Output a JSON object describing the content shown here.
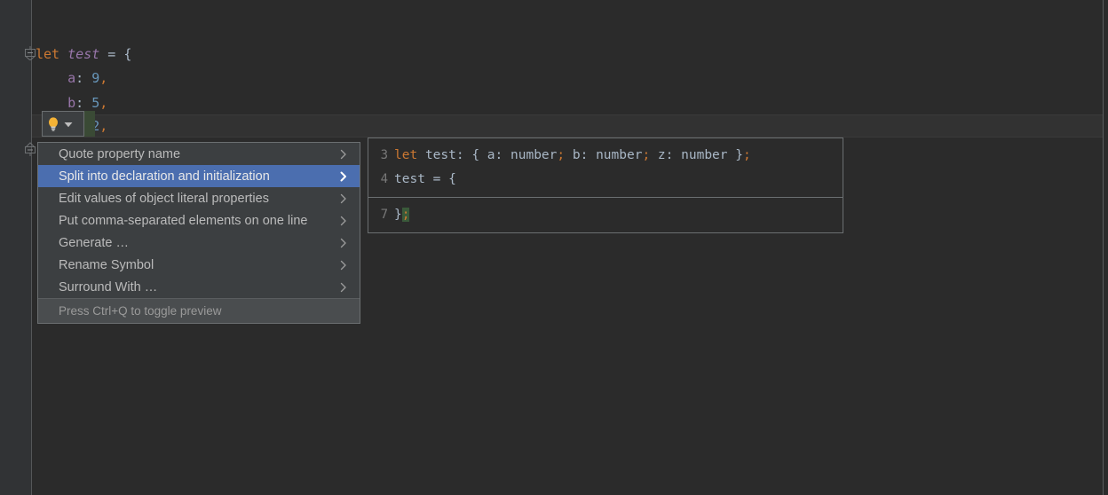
{
  "editor": {
    "background_color": "#2b2b2b",
    "gutter_color": "#313335",
    "current_line_color": "#323232",
    "lines": [
      {
        "indent": 0,
        "tokens": [
          {
            "text": "let",
            "cls": "kw"
          },
          {
            "text": " ",
            "cls": "op"
          },
          {
            "text": "test",
            "cls": "ident"
          },
          {
            "text": " ",
            "cls": "op"
          },
          {
            "text": "=",
            "cls": "op"
          },
          {
            "text": " ",
            "cls": "op"
          },
          {
            "text": "{",
            "cls": "brace"
          }
        ]
      },
      {
        "indent": 1,
        "tokens": [
          {
            "text": "a",
            "cls": "prop"
          },
          {
            "text": ":",
            "cls": "punc"
          },
          {
            "text": " ",
            "cls": "op"
          },
          {
            "text": "9",
            "cls": "num"
          },
          {
            "text": ",",
            "cls": "comma"
          }
        ]
      },
      {
        "indent": 1,
        "tokens": [
          {
            "text": "b",
            "cls": "prop"
          },
          {
            "text": ":",
            "cls": "punc"
          },
          {
            "text": " ",
            "cls": "op"
          },
          {
            "text": "5",
            "cls": "num"
          },
          {
            "text": ",",
            "cls": "comma"
          }
        ]
      },
      {
        "indent": 1,
        "tokens": [
          {
            "text": "z",
            "cls": "prop"
          },
          {
            "text": ":",
            "cls": "punc"
          },
          {
            "text": " ",
            "cls": "op"
          },
          {
            "text": "2",
            "cls": "num"
          },
          {
            "text": ",",
            "cls": "comma"
          }
        ]
      }
    ],
    "line_texts": [
      "let test = {",
      "    a: 9,",
      "    b: 5,",
      "    z: 2,"
    ]
  },
  "bulb_widget": {
    "icon": "lightbulb-icon",
    "arrow": "dropdown-arrow-icon",
    "accent_color": "#f5b335"
  },
  "intention_menu": {
    "items": [
      {
        "label": "Quote property name",
        "selected": false
      },
      {
        "label": "Split into declaration and initialization",
        "selected": true
      },
      {
        "label": "Edit values of object literal properties",
        "selected": false
      },
      {
        "label": "Put comma-separated elements on one line",
        "selected": false
      },
      {
        "label": "Generate …",
        "selected": false
      },
      {
        "label": "Rename Symbol",
        "selected": false
      },
      {
        "label": "Surround With …",
        "selected": false
      }
    ],
    "footer_hint": "Press Ctrl+Q to toggle preview",
    "selection_color": "#4b6eaf",
    "background_color": "#3c3f41"
  },
  "preview_panel": {
    "blocks": [
      {
        "lines": [
          {
            "number": "3",
            "tokens": [
              {
                "text": "let",
                "cls": "kw"
              },
              {
                "text": " ",
                "cls": "op"
              },
              {
                "text": "test",
                "cls": "type"
              },
              {
                "text": ":",
                "cls": "punc"
              },
              {
                "text": " ",
                "cls": "op"
              },
              {
                "text": "{",
                "cls": "brace"
              },
              {
                "text": " ",
                "cls": "op"
              },
              {
                "text": "a",
                "cls": "type"
              },
              {
                "text": ":",
                "cls": "punc"
              },
              {
                "text": " ",
                "cls": "op"
              },
              {
                "text": "number",
                "cls": "type"
              },
              {
                "text": ";",
                "cls": "comma"
              },
              {
                "text": " ",
                "cls": "op"
              },
              {
                "text": "b",
                "cls": "type"
              },
              {
                "text": ":",
                "cls": "punc"
              },
              {
                "text": " ",
                "cls": "op"
              },
              {
                "text": "number",
                "cls": "type"
              },
              {
                "text": ";",
                "cls": "comma"
              },
              {
                "text": " ",
                "cls": "op"
              },
              {
                "text": "z",
                "cls": "type"
              },
              {
                "text": ":",
                "cls": "punc"
              },
              {
                "text": " ",
                "cls": "op"
              },
              {
                "text": "number",
                "cls": "type"
              },
              {
                "text": " ",
                "cls": "op"
              },
              {
                "text": "}",
                "cls": "brace"
              },
              {
                "text": ";",
                "cls": "comma"
              }
            ],
            "plain": "let test: { a: number; b: number; z: number };"
          },
          {
            "number": "4",
            "tokens": [
              {
                "text": "test",
                "cls": "type"
              },
              {
                "text": " ",
                "cls": "op"
              },
              {
                "text": "=",
                "cls": "op"
              },
              {
                "text": " ",
                "cls": "op"
              },
              {
                "text": "{",
                "cls": "brace"
              }
            ],
            "plain": "test = {"
          }
        ]
      },
      {
        "lines": [
          {
            "number": "7",
            "tokens": [
              {
                "text": "}",
                "cls": "brace"
              },
              {
                "text": ";",
                "cls": "added-hl"
              }
            ],
            "plain": "};"
          }
        ]
      }
    ]
  }
}
